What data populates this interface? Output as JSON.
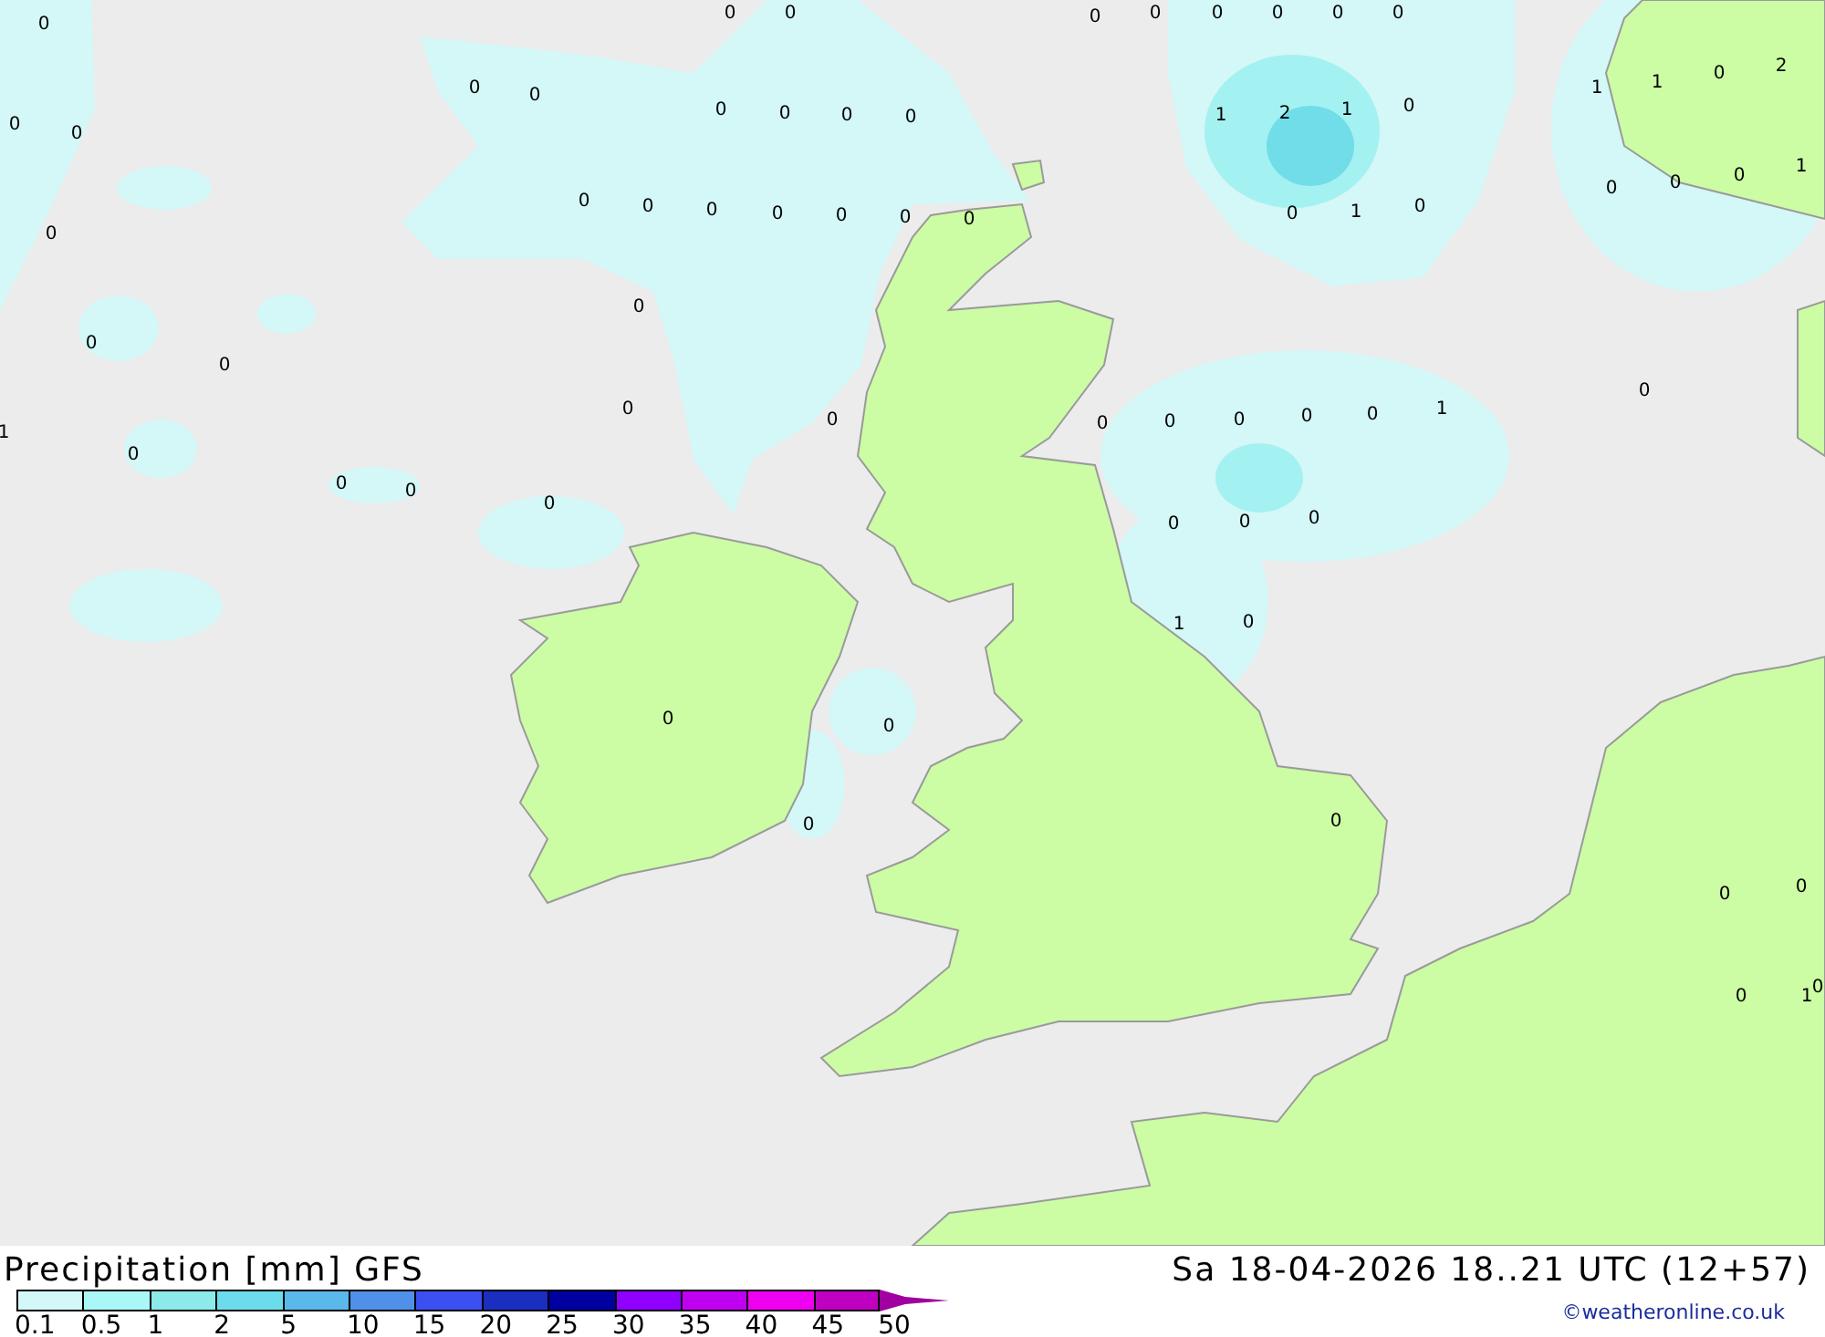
{
  "map_labels": [
    "0",
    "0",
    "0",
    "0",
    "0",
    "0",
    "0",
    "0",
    "0",
    "0",
    "0",
    "0",
    "0",
    "0",
    "0",
    "0",
    "0",
    "1",
    "2",
    "1",
    "0",
    "1",
    "1",
    "0",
    "2",
    "0",
    "0",
    "0",
    "0",
    "0",
    "0",
    "0",
    "0",
    "0",
    "1",
    "0",
    "0",
    "0",
    "0",
    "1",
    "0",
    "0",
    "0",
    "0",
    "0",
    "0",
    "0",
    "0",
    "0",
    "0",
    "0",
    "1",
    "1",
    "0",
    "0",
    "0",
    "0",
    "0",
    "0",
    "0",
    "1",
    "0",
    "0",
    "0",
    "0",
    "0",
    "0",
    "0",
    "0",
    "0",
    "1"
  ],
  "title": "Precipitation [mm] GFS",
  "valid_time": "Sa 18-04-2026 18..21 UTC (12+57)",
  "legend": [
    {
      "label": "0.1",
      "color": "#d4f7f7"
    },
    {
      "label": "0.5",
      "color": "#aaf7f7"
    },
    {
      "label": "1",
      "color": "#8ceaea"
    },
    {
      "label": "2",
      "color": "#6cdcec"
    },
    {
      "label": "5",
      "color": "#5ab8ea"
    },
    {
      "label": "10",
      "color": "#5090e8"
    },
    {
      "label": "15",
      "color": "#3a50f0"
    },
    {
      "label": "20",
      "color": "#1a2ec0"
    },
    {
      "label": "25",
      "color": "#0000a0"
    },
    {
      "label": "30",
      "color": "#9000ff"
    },
    {
      "label": "35",
      "color": "#c000f0"
    },
    {
      "label": "40",
      "color": "#f000f0"
    },
    {
      "label": "45",
      "color": "#c000c0"
    },
    {
      "label": "50",
      "color": "#a000a0"
    }
  ],
  "credit": "©weatheronline.co.uk"
}
